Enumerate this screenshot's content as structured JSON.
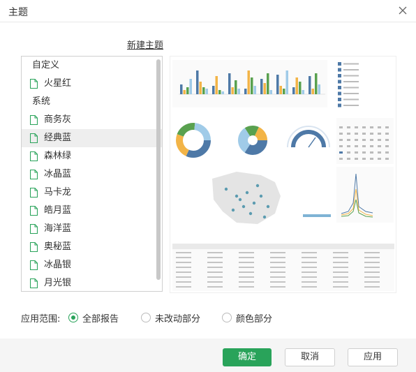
{
  "dialog": {
    "title": "主题"
  },
  "new_theme_link": "新建主题",
  "theme_list": {
    "custom_group": "自定义",
    "custom_items": [
      "火星红"
    ],
    "system_group": "系统",
    "system_items": [
      "商务灰",
      "经典蓝",
      "森林绿",
      "冰晶蓝",
      "马卡龙",
      "皓月蓝",
      "海洋蓝",
      "奥秘蓝",
      "冰晶银",
      "月光银"
    ],
    "selected": "经典蓝"
  },
  "scope": {
    "label": "应用范围:",
    "options": [
      "全部报告",
      "未改动部分",
      "颜色部分"
    ],
    "selected": "全部报告"
  },
  "buttons": {
    "ok": "确定",
    "cancel": "取消",
    "apply": "应用"
  },
  "colors": {
    "accent": "#29a35a",
    "preview_blue": "#4e79a7",
    "preview_orange": "#f2b447",
    "preview_green": "#59a14f",
    "preview_lightblue": "#a0cbe8"
  },
  "icons": {
    "close": "close-icon",
    "theme_item": "document-icon"
  }
}
